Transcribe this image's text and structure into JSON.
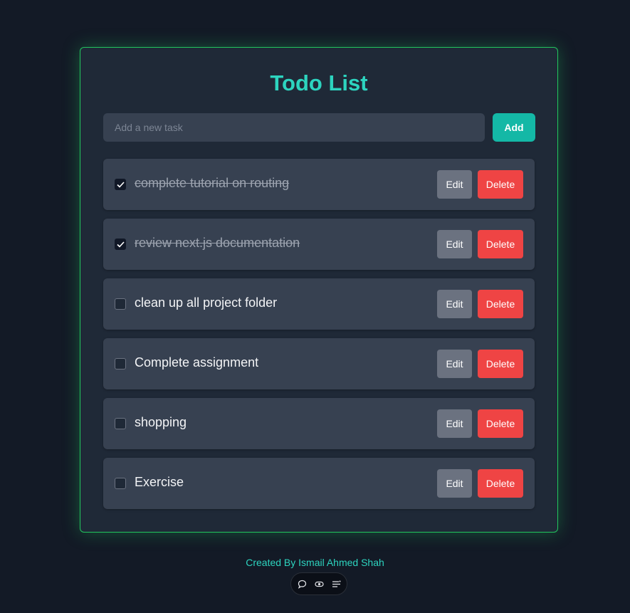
{
  "app": {
    "title": "Todo List"
  },
  "input": {
    "placeholder": "Add a new task",
    "value": ""
  },
  "add_button_label": "Add",
  "todos": [
    {
      "text": "complete tutorial on routing",
      "completed": true,
      "edit_label": "Edit",
      "delete_label": "Delete"
    },
    {
      "text": "review next.js documentation",
      "completed": true,
      "edit_label": "Edit",
      "delete_label": "Delete"
    },
    {
      "text": "clean up all project folder",
      "completed": false,
      "edit_label": "Edit",
      "delete_label": "Delete"
    },
    {
      "text": "Complete assignment",
      "completed": false,
      "edit_label": "Edit",
      "delete_label": "Delete"
    },
    {
      "text": "shopping",
      "completed": false,
      "edit_label": "Edit",
      "delete_label": "Delete"
    },
    {
      "text": "Exercise",
      "completed": false,
      "edit_label": "Edit",
      "delete_label": "Delete"
    }
  ],
  "footer": {
    "text": "Created By Ismail Ahmed Shah"
  },
  "toolbar": {
    "icons": [
      "chat-icon",
      "eye-icon",
      "menu-icon"
    ]
  },
  "colors": {
    "accent": "#2dd4bf",
    "add_button": "#14b8a6",
    "delete_button": "#ef4444",
    "edit_button": "#6b7280",
    "card_border": "#22c55e"
  }
}
